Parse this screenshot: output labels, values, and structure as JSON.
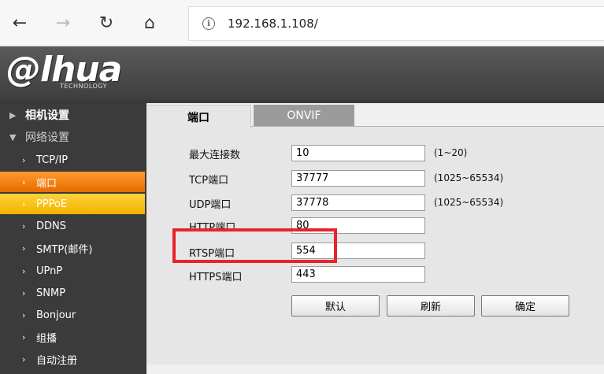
{
  "browser": {
    "url": "192.168.1.108/",
    "back_glyph": "←",
    "forward_glyph": "→",
    "refresh_glyph": "↻",
    "home_glyph": "⌂",
    "info_glyph": "i"
  },
  "brand": {
    "logo": "a hua",
    "logo_text": "@lhua",
    "sub": "TECHNOLOGY"
  },
  "sidebar": {
    "items": [
      {
        "label": "相机设置",
        "arrow": "▶"
      },
      {
        "label": "网络设置",
        "arrow": "▼"
      },
      {
        "label": "TCP/IP",
        "arrow": "›"
      },
      {
        "label": "端口",
        "arrow": "›"
      },
      {
        "label": "PPPoE",
        "arrow": "›"
      },
      {
        "label": "DDNS",
        "arrow": "›"
      },
      {
        "label": "SMTP(邮件)",
        "arrow": "›"
      },
      {
        "label": "UPnP",
        "arrow": "›"
      },
      {
        "label": "SNMP",
        "arrow": "›"
      },
      {
        "label": "Bonjour",
        "arrow": "›"
      },
      {
        "label": "组播",
        "arrow": "›"
      },
      {
        "label": "自动注册",
        "arrow": "›"
      }
    ]
  },
  "tabs": {
    "active": "端口",
    "inactive": "ONVIF"
  },
  "form": {
    "rows": [
      {
        "label": "最大连接数",
        "value": "10",
        "hint": "(1~20)"
      },
      {
        "label": "TCP端口",
        "value": "37777",
        "hint": "(1025~65534)"
      },
      {
        "label": "UDP端口",
        "value": "37778",
        "hint": "(1025~65534)"
      },
      {
        "label": "HTTP端口",
        "value": "80",
        "hint": ""
      },
      {
        "label": "RTSP端口",
        "value": "554",
        "hint": ""
      },
      {
        "label": "HTTPS端口",
        "value": "443",
        "hint": ""
      }
    ],
    "buttons": {
      "default": "默认",
      "refresh": "刷新",
      "confirm": "确定"
    }
  },
  "colors": {
    "active_item": "#f08a1c",
    "hover_item": "#f7c51b",
    "highlight": "#e8232a"
  }
}
